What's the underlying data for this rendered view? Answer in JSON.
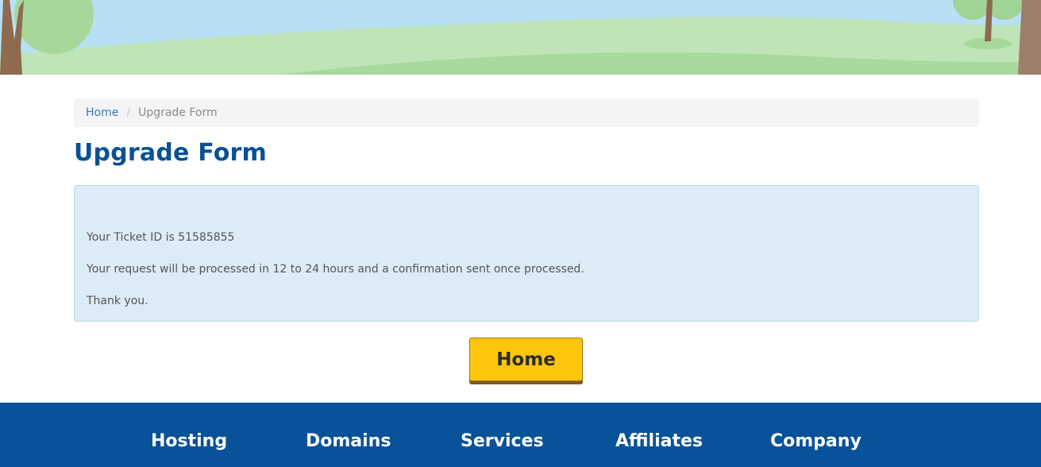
{
  "breadcrumb": {
    "home": "Home",
    "separator": "/",
    "current": "Upgrade Form"
  },
  "page": {
    "title": "Upgrade Form"
  },
  "alert": {
    "line1": "Your Ticket ID is 51585855",
    "line2": "Your request will be processed in 12 to 24 hours and a confirmation sent once processed.",
    "line3": "Thank you."
  },
  "button": {
    "home": "Home"
  },
  "footer": {
    "nav": [
      "Hosting",
      "Domains",
      "Services",
      "Affiliates",
      "Company"
    ]
  },
  "colors": {
    "brand_blue": "#075298",
    "title_blue": "#0a5194",
    "button_yellow": "#fec50d",
    "alert_bg": "#dbecf6"
  }
}
